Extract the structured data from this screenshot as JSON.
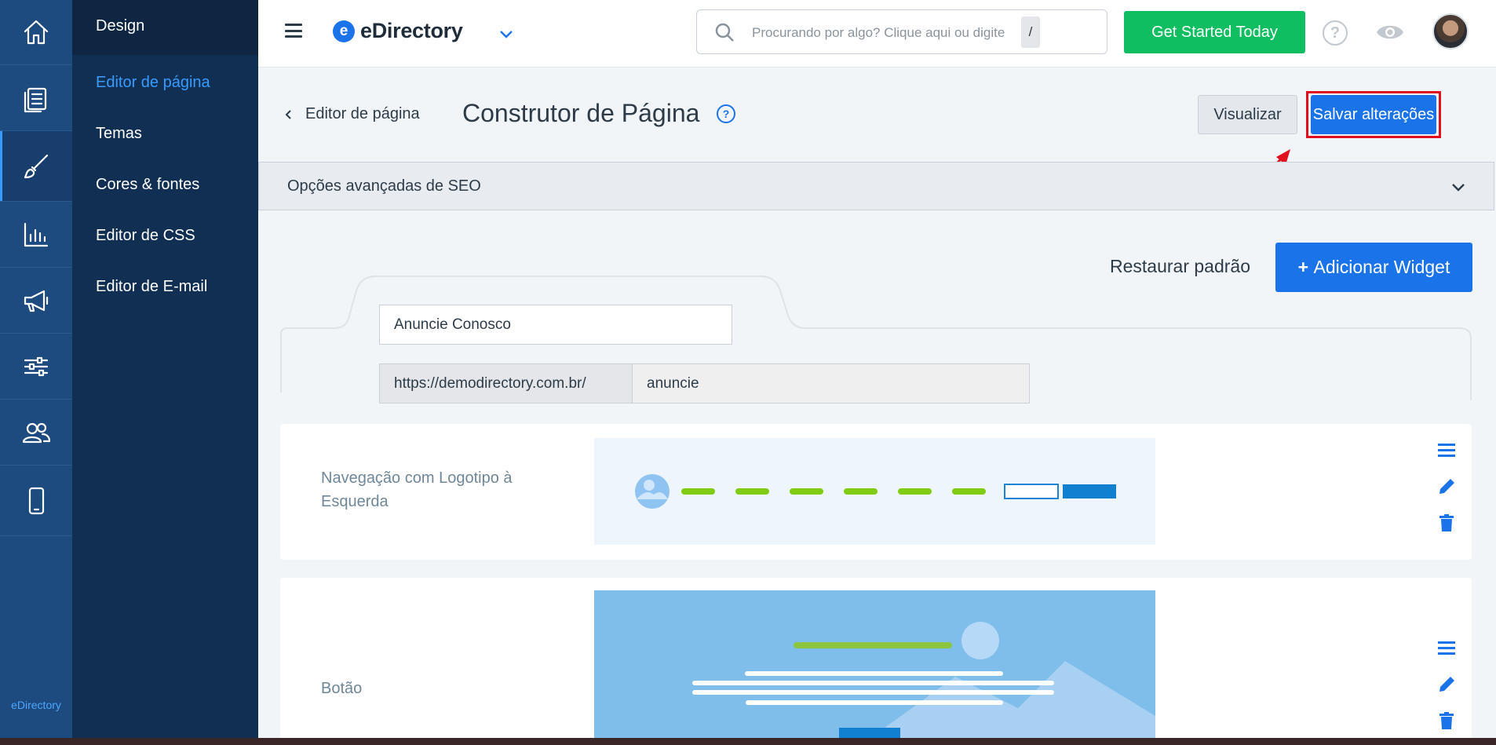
{
  "rail": {
    "items": [
      {
        "icon": "home-icon"
      },
      {
        "icon": "pages-icon"
      },
      {
        "icon": "brush-icon",
        "active": true
      },
      {
        "icon": "chart-icon"
      },
      {
        "icon": "megaphone-icon"
      },
      {
        "icon": "sliders-icon"
      },
      {
        "icon": "users-icon"
      },
      {
        "icon": "mobile-icon"
      }
    ],
    "brand": "eDirectory"
  },
  "submenu": {
    "heading": "Design",
    "items": [
      {
        "label": "Editor de página",
        "active": true
      },
      {
        "label": "Temas"
      },
      {
        "label": "Cores & fontes"
      },
      {
        "label": "Editor de CSS"
      },
      {
        "label": "Editor de E-mail"
      }
    ]
  },
  "topbar": {
    "brand_logo": "e",
    "brand_name": "eDirectory",
    "search_placeholder": "Procurando por algo? Clique aqui ou digite",
    "search_shortcut": "/",
    "cta_label": "Get Started Today",
    "help_glyph": "?"
  },
  "page": {
    "back_label": "Editor de página",
    "title": "Construtor de Página",
    "title_help_glyph": "?",
    "preview_label": "Visualizar",
    "save_label": "Salvar alterações"
  },
  "seo": {
    "label": "Opções avançadas de SEO"
  },
  "widgets": {
    "restore_label": "Restaurar padrão",
    "add_label": "Adicionar Widget",
    "page_name": "Anuncie Conosco",
    "url_prefix": "https://demodirectory.com.br/",
    "url_slug": "anuncie",
    "list": [
      {
        "label": "Navegação com Logotipo à Esquerda"
      },
      {
        "label": "Botão"
      }
    ]
  },
  "colors": {
    "rail_bg": "#1d4a7f",
    "submenu_bg": "#112f52",
    "primary": "#1a73e8",
    "cta_green": "#0fbe60",
    "annotation_red": "#e0101e"
  }
}
